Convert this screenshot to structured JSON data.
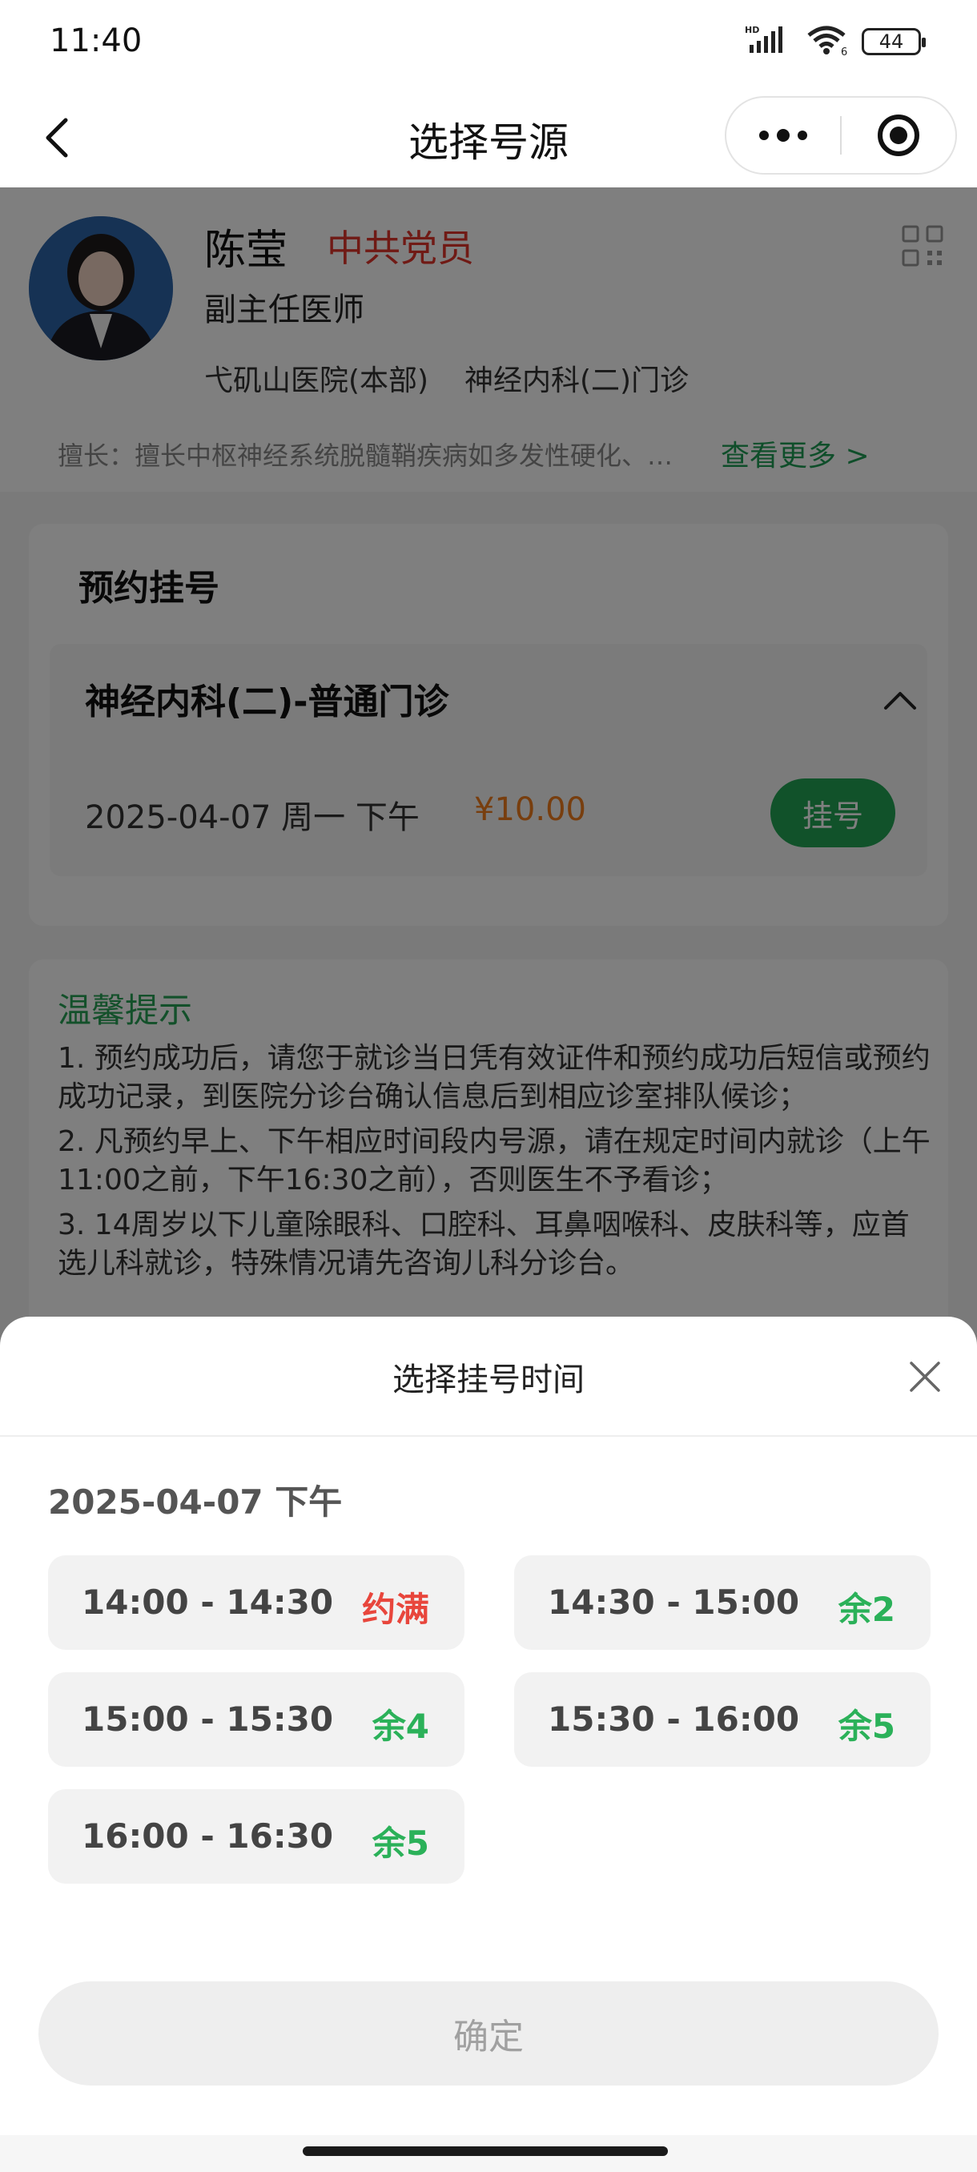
{
  "status_bar": {
    "time": "11:40",
    "battery": "44",
    "hd_label": "HD",
    "wifi_sub": "6"
  },
  "nav": {
    "title": "选择号源"
  },
  "doctor": {
    "name": "陈莹",
    "party": "中共党员",
    "title": "副主任医师",
    "hospital": "弋矶山医院(本部)",
    "department": "神经内科(二)门诊",
    "specialty": "擅长：擅长中枢神经系统脱髓鞘疾病如多发性硬化、视神经脊髓炎谱系疾病",
    "see_more": "查看更多 >"
  },
  "booking": {
    "heading": "预约挂号",
    "dept_name": "神经内科(二)-普通门诊",
    "date_text": "2025-04-07  周一  下午",
    "price": "¥10.00",
    "register_label": "挂号"
  },
  "tips": {
    "title": "温馨提示",
    "items": [
      "1. 预约成功后，请您于就诊当日凭有效证件和预约成功后短信或预约成功记录，到医院分诊台确认信息后到相应诊室排队候诊；",
      "2. 凡预约早上、下午相应时间段内号源，请在规定时间内就诊（上午11:00之前，下午16:30之前），否则医生不予看诊；",
      "3. 14周岁以下儿童除眼科、口腔科、耳鼻咽喉科、皮肤科等，应首选儿科就诊，特殊情况请先咨询儿科分诊台。"
    ]
  },
  "sheet": {
    "title": "选择挂号时间",
    "date": "2025-04-07  下午",
    "slots": [
      {
        "time": "14:00 - 14:30",
        "status": "约满",
        "status_color": "#e8463c"
      },
      {
        "time": "14:30 - 15:00",
        "status": "余2",
        "status_color": "#2bb159"
      },
      {
        "time": "15:00 - 15:30",
        "status": "余4",
        "status_color": "#2bb159"
      },
      {
        "time": "15:30 - 16:00",
        "status": "余5",
        "status_color": "#2bb159"
      },
      {
        "time": "16:00 - 16:30",
        "status": "余5",
        "status_color": "#2bb159"
      }
    ],
    "confirm_label": "确定"
  },
  "colors": {
    "accent_green": "#23a455",
    "price_orange": "#f07c1c",
    "party_red": "#e0352b"
  }
}
